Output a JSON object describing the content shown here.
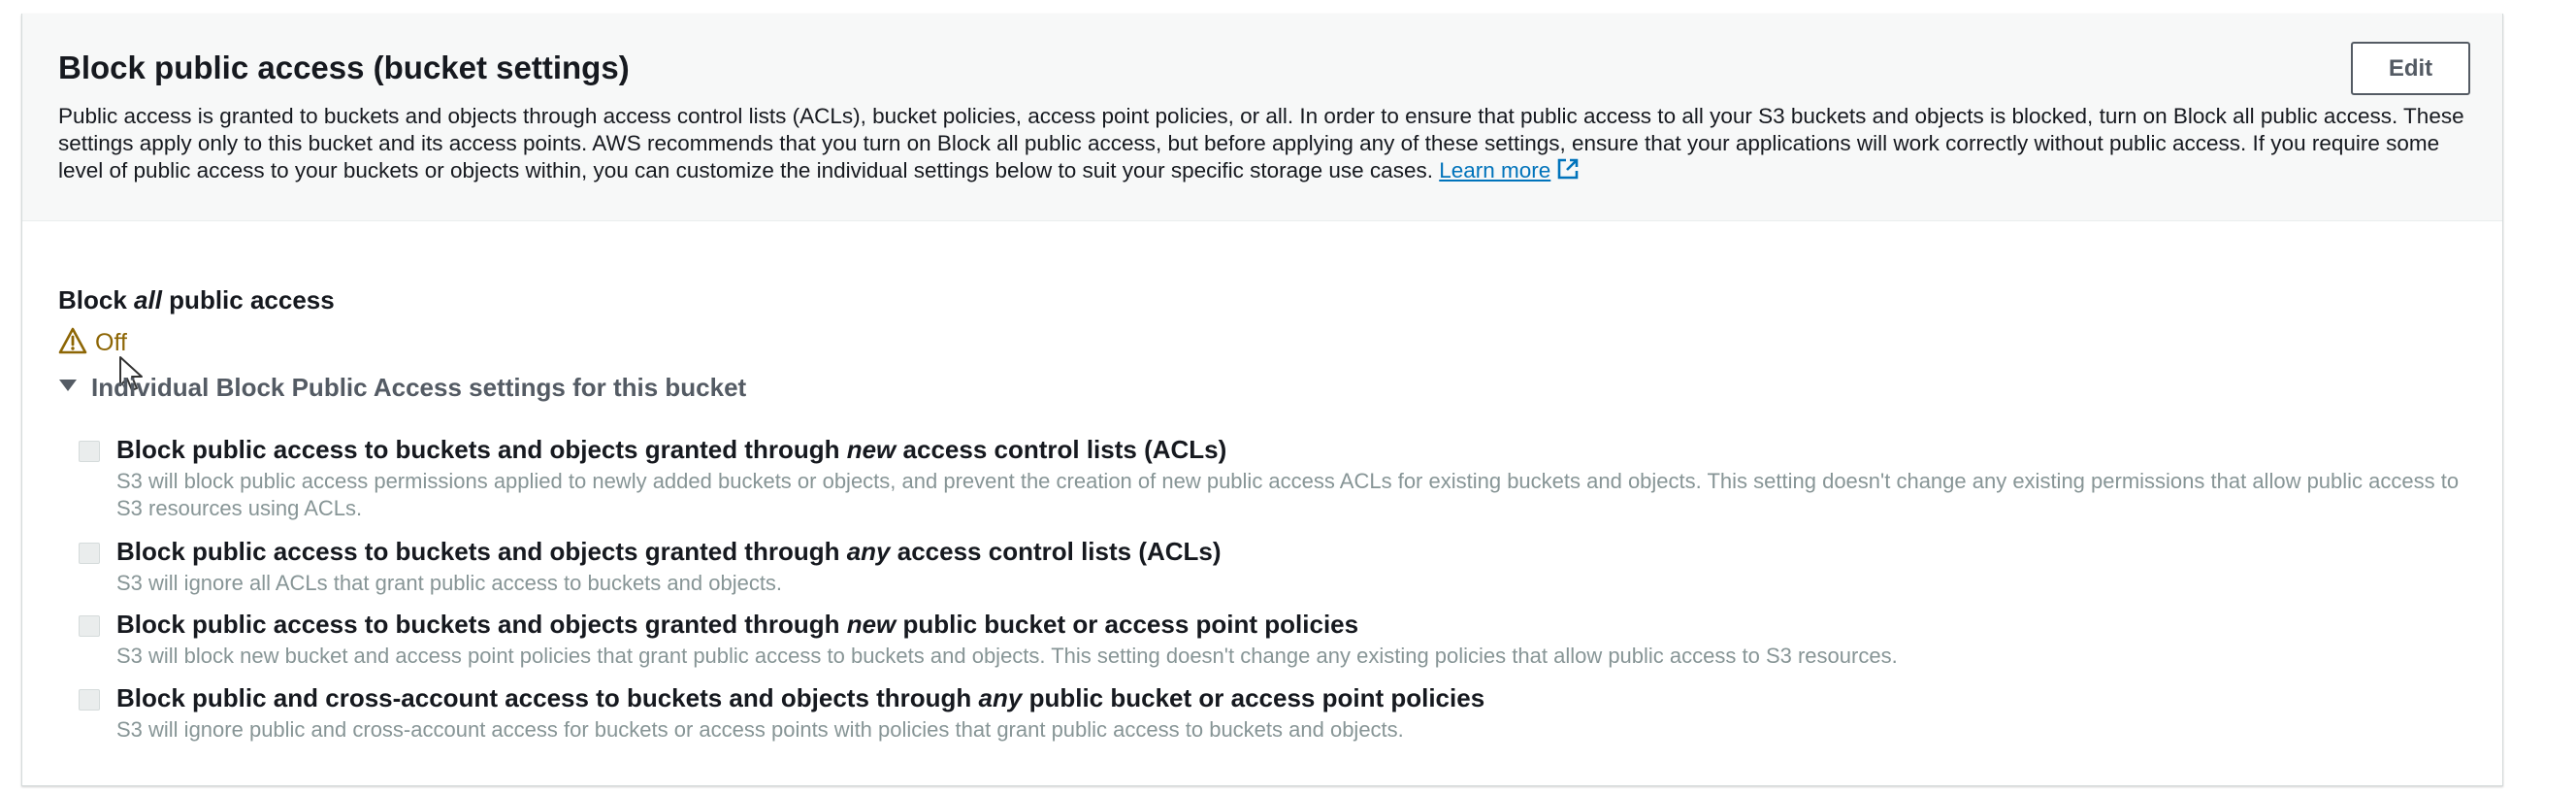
{
  "panel": {
    "title": "Block public access (bucket settings)",
    "edit_label": "Edit",
    "description": "Public access is granted to buckets and objects through access control lists (ACLs), bucket policies, access point policies, or all. In order to ensure that public access to all your S3 buckets and objects is blocked, turn on Block all public access. These settings apply only to this bucket and its access points. AWS recommends that you turn on Block all public access, but before applying any of these settings, ensure that your applications will work correctly without public access. If you require some level of public access to your buckets or objects within, you can customize the individual settings below to suit your specific storage use cases.",
    "learn_more": "Learn more"
  },
  "block_all": {
    "label_prefix": "Block ",
    "label_emphasis": "all",
    "label_suffix": " public access",
    "status": "Off",
    "status_icon": "warning-icon",
    "status_color": "#8d6605"
  },
  "individual": {
    "expander_label": "Individual Block Public Access settings for this bucket",
    "expander_icon": "caret-down-icon",
    "settings": [
      {
        "title_prefix": "Block public access to buckets and objects granted through ",
        "title_emphasis": "new",
        "title_suffix": " access control lists (ACLs)",
        "description": "S3 will block public access permissions applied to newly added buckets or objects, and prevent the creation of new public access ACLs for existing buckets and objects. This setting doesn't change any existing permissions that allow public access to S3 resources using ACLs.",
        "checked": false
      },
      {
        "title_prefix": "Block public access to buckets and objects granted through ",
        "title_emphasis": "any",
        "title_suffix": " access control lists (ACLs)",
        "description": "S3 will ignore all ACLs that grant public access to buckets and objects.",
        "checked": false
      },
      {
        "title_prefix": "Block public access to buckets and objects granted through ",
        "title_emphasis": "new",
        "title_suffix": " public bucket or access point policies",
        "description": "S3 will block new bucket and access point policies that grant public access to buckets and objects. This setting doesn't change any existing policies that allow public access to S3 resources.",
        "checked": false
      },
      {
        "title_prefix": "Block public and cross-account access to buckets and objects through ",
        "title_emphasis": "any",
        "title_suffix": " public bucket or access point policies",
        "description": "S3 will ignore public and cross-account access for buckets or access points with policies that grant public access to buckets and objects.",
        "checked": false
      }
    ]
  },
  "colors": {
    "link": "#0073bb",
    "warning": "#8d6605",
    "muted_text": "#879596"
  }
}
